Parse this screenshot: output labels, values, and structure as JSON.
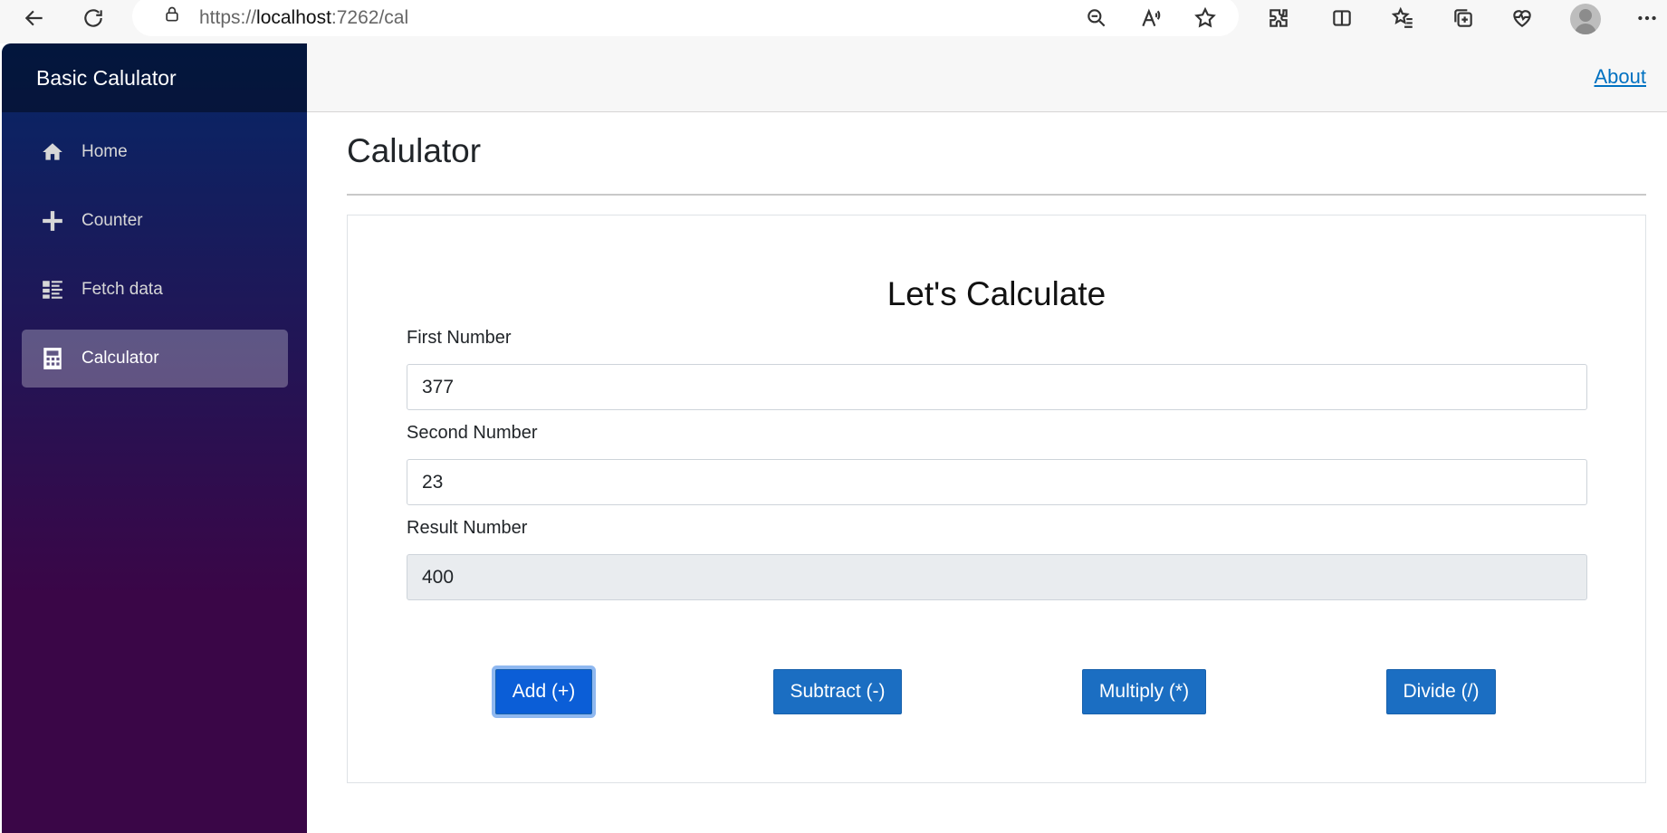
{
  "browser": {
    "url_prefix": "https://",
    "url_host": "localhost",
    "url_rest": ":7262/cal"
  },
  "sidebar": {
    "brand": "Basic Calulator",
    "items": [
      {
        "label": "Home",
        "icon": "home-icon"
      },
      {
        "label": "Counter",
        "icon": "plus-icon"
      },
      {
        "label": "Fetch data",
        "icon": "list-icon"
      },
      {
        "label": "Calculator",
        "icon": "calculator-icon",
        "active": true
      }
    ]
  },
  "header": {
    "about_label": "About"
  },
  "main": {
    "page_title": "Calulator",
    "card_heading": "Let's Calculate",
    "first_label": "First Number",
    "first_value": "377",
    "second_label": "Second Number",
    "second_value": "23",
    "result_label": "Result Number",
    "result_value": "400",
    "buttons": {
      "add": "Add (+)",
      "subtract": "Subtract (-)",
      "multiply": "Multiply (*)",
      "divide": "Divide (/)"
    }
  },
  "colors": {
    "accent": "#1b6ec2",
    "sidebar_top": "#052767",
    "sidebar_bottom": "#3a0647"
  }
}
